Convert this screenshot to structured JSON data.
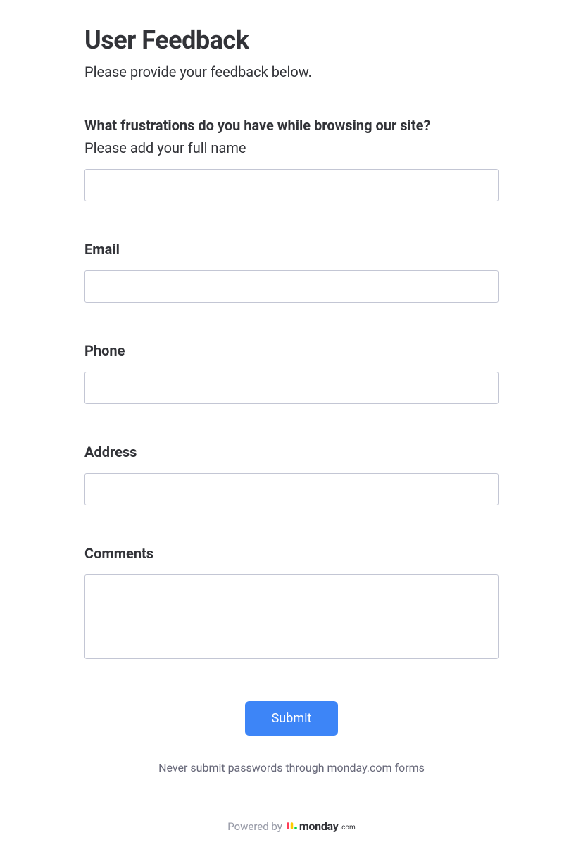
{
  "header": {
    "title": "User Feedback",
    "subtitle": "Please provide your feedback below."
  },
  "fields": {
    "frustrations": {
      "label": "What frustrations do you have while browsing our site?",
      "description": "Please add your full name",
      "value": ""
    },
    "email": {
      "label": "Email",
      "value": ""
    },
    "phone": {
      "label": "Phone",
      "value": ""
    },
    "address": {
      "label": "Address",
      "value": ""
    },
    "comments": {
      "label": "Comments",
      "value": ""
    }
  },
  "submit": {
    "label": "Submit"
  },
  "footer": {
    "warning": "Never submit passwords through monday.com forms",
    "powered_prefix": "Powered by",
    "brand": "monday",
    "brand_suffix": ".com"
  }
}
